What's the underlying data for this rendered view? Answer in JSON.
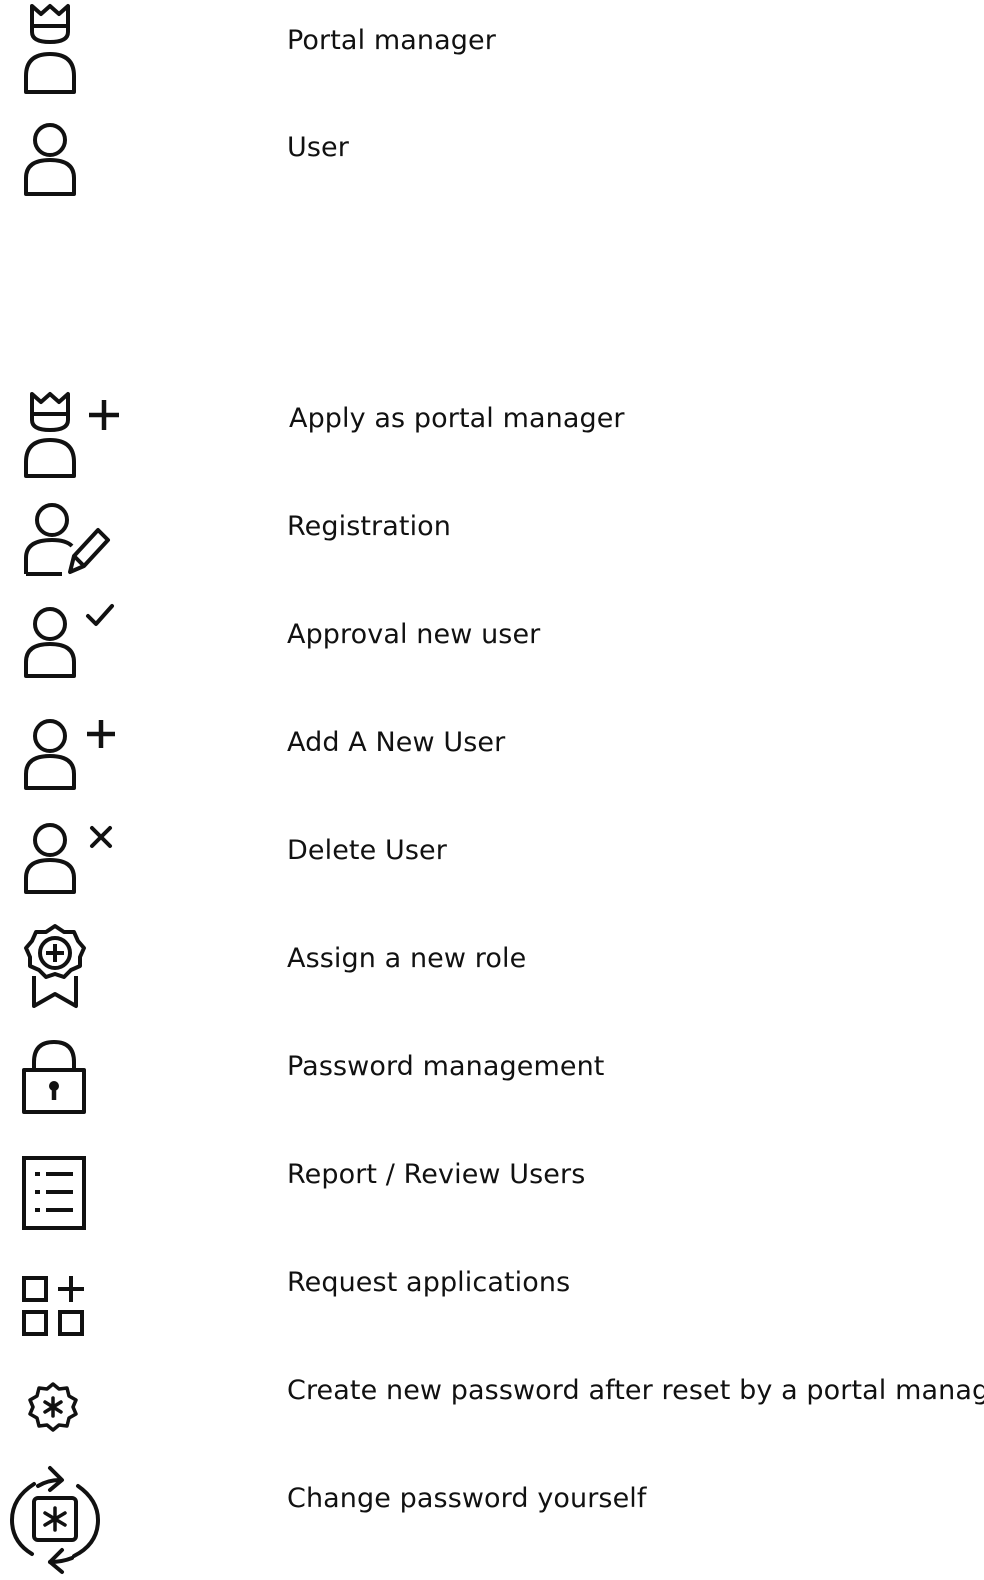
{
  "ink_color": "#111111",
  "background_color": "#ffffff",
  "roles": [
    {
      "icon": "portal-manager-icon",
      "label": "Portal manager"
    },
    {
      "icon": "user-icon",
      "label": "User"
    }
  ],
  "actions": [
    {
      "icon": "apply-portal-manager-icon",
      "label": "Apply as portal manager"
    },
    {
      "icon": "registration-icon",
      "label": "Registration"
    },
    {
      "icon": "approve-user-icon",
      "label": "Approval new user"
    },
    {
      "icon": "add-user-icon",
      "label": "Add A New User"
    },
    {
      "icon": "delete-user-icon",
      "label": "Delete User"
    },
    {
      "icon": "assign-role-icon",
      "label": "Assign a new role"
    },
    {
      "icon": "lock-icon",
      "label": "Password management"
    },
    {
      "icon": "report-list-icon",
      "label": "Report / Review Users"
    },
    {
      "icon": "request-apps-icon",
      "label": "Request applications"
    },
    {
      "icon": "reset-password-gear-icon",
      "label": "Create new password after reset by a portal manager"
    },
    {
      "icon": "change-password-icon",
      "label": "Change password yourself"
    }
  ]
}
